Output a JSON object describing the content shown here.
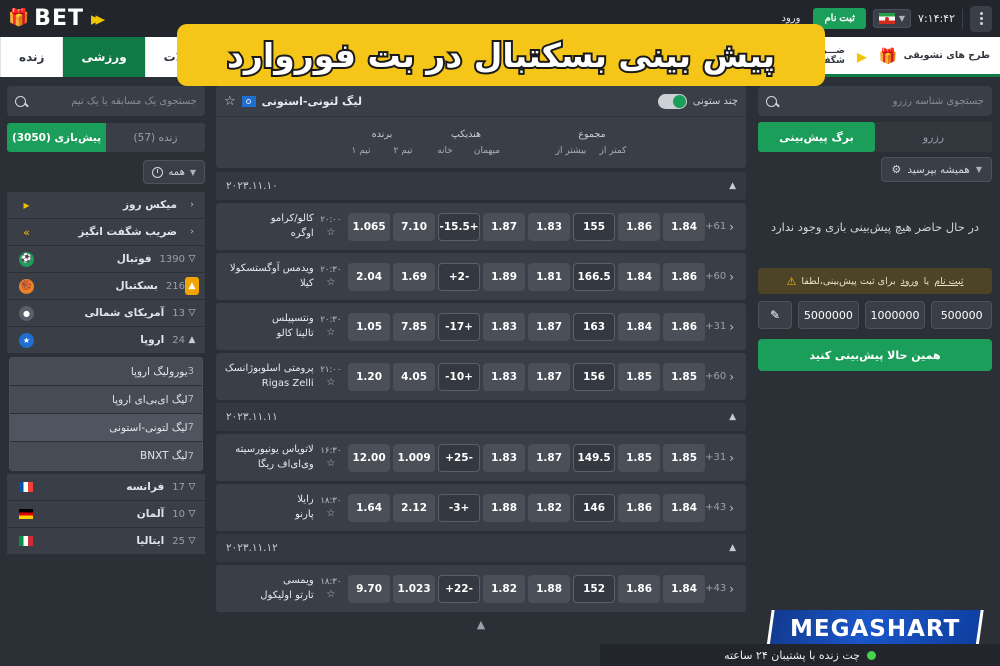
{
  "topbar": {
    "login_label": "ورود",
    "signup_label": "ثبت نام",
    "time": "۷:۱۴:۴۲",
    "brand_name": "BET",
    "lang": "فارسی"
  },
  "navbar": {
    "tabs": [
      {
        "label": "زنده",
        "active": false
      },
      {
        "label": "ورزشی",
        "active": true
      },
      {
        "label": "اسلات",
        "active": false
      }
    ],
    "promos": [
      {
        "label": "طرح های تشویقی"
      },
      {
        "label_line1": "ضـــریــب",
        "label_line2": "شگفت انگیـــز"
      }
    ]
  },
  "banner": {
    "title": "پیش بینی بسکتبال در بت فوروارد"
  },
  "right_sidebar": {
    "search_placeholder": "جستجوی یک مسابقه یا یک تیم",
    "tabs": [
      {
        "label": "پیش‌بازی (3050)",
        "active": true
      },
      {
        "label": "زنده (57)",
        "active": false
      }
    ],
    "filter": {
      "label": "همه"
    },
    "sports": [
      {
        "label": "میکس روز",
        "count": "",
        "icon": "mixday-icon",
        "chev": "‹",
        "color": "#f0c000"
      },
      {
        "label": "ضریب شگفت انگیز",
        "count": "",
        "icon": "double-arrow-icon",
        "chev": "‹",
        "color": "#f0c000"
      },
      {
        "label": "فوتبال",
        "count": "1390",
        "icon": "football-icon",
        "chev": "⌄",
        "color": "#1c9e5b"
      },
      {
        "label": "بسکتبال",
        "count": "216",
        "icon": "basketball-icon",
        "chev": "⌃",
        "color": "#e8832a",
        "selected": true
      },
      {
        "label": "آمریکای شمالی",
        "count": "13",
        "icon": "region-icon",
        "chev": "⌄",
        "color": "#5a606a"
      },
      {
        "label": "اروپا",
        "count": "24",
        "icon": "europe-icon",
        "chev": "⌃",
        "color": "#1f6fd0",
        "expanded": true
      }
    ],
    "leagues": [
      {
        "name": "یورولیگ اروپا",
        "count": "3"
      },
      {
        "name": "لیگ ای‌بی‌ای اروپا",
        "count": "7"
      },
      {
        "name": "لیگ لتونی-استونی",
        "count": "7",
        "active": true
      },
      {
        "name": "لیگ BNXT",
        "count": "7"
      }
    ],
    "countries": [
      {
        "name": "فرانسه",
        "count": "17",
        "flag": "fl-fr"
      },
      {
        "name": "آلمان",
        "count": "10",
        "flag": "fl-de"
      },
      {
        "name": "ایتالیا",
        "count": "25",
        "flag": "fl-it"
      }
    ]
  },
  "center": {
    "league_title": "لیگ لتونی-استونی",
    "multicolumn_label": "چند ستونی",
    "col_groups": [
      {
        "title": "برنده",
        "subs": [
          "تیم ۱",
          "تیم ۲"
        ]
      },
      {
        "title": "هندیکپ",
        "subs": [
          "خانه",
          "میهمان"
        ]
      },
      {
        "title": "مجموع",
        "subs": [
          "بیشتر از",
          "کمتر از"
        ]
      }
    ],
    "sections": [
      {
        "date": "۲۰۲۳.۱۱.۱۰",
        "matches": [
          {
            "team1": "کالو/کرامو",
            "team2": "اوگره",
            "time": "۲۰:۰۰",
            "o1": "1.065",
            "o2": "7.10",
            "hline": "+15.5-",
            "h1": "1.87",
            "h2": "1.83",
            "tline": "155",
            "tover": "1.86",
            "tunder": "1.84",
            "more": "61+"
          },
          {
            "team1": "ویدمس آوگستسکولا",
            "team2": "کیلا",
            "time": "۲۰:۳۰",
            "o1": "2.04",
            "o2": "1.69",
            "hline": "-2+",
            "h1": "1.89",
            "h2": "1.81",
            "tline": "166.5",
            "tover": "1.84",
            "tunder": "1.86",
            "more": "60+"
          },
          {
            "team1": "ونتسپیلس",
            "team2": "تالینا کالو",
            "time": "۲۰:۳۰",
            "o1": "1.05",
            "o2": "7.85",
            "hline": "+17-",
            "h1": "1.83",
            "h2": "1.87",
            "tline": "163",
            "tover": "1.84",
            "tunder": "1.86",
            "more": "31+"
          },
          {
            "team1": "پرومتی اسلوبوژانسک",
            "team2": "Rigas Zelli",
            "time": "۲۱:۰۰",
            "o1": "1.20",
            "o2": "4.05",
            "hline": "+10-",
            "h1": "1.83",
            "h2": "1.87",
            "tline": "156",
            "tover": "1.85",
            "tunder": "1.85",
            "more": "60+"
          }
        ]
      },
      {
        "date": "۲۰۲۳.۱۱.۱۱",
        "matches": [
          {
            "team1": "لاتویاس یونیورسیته",
            "team2": "وی‌ای‌اف ریگا",
            "time": "۱۶:۳۰",
            "o1": "12.00",
            "o2": "1.009",
            "hline": "-25+",
            "h1": "1.83",
            "h2": "1.87",
            "tline": "149.5",
            "tover": "1.85",
            "tunder": "1.85",
            "more": "31+"
          },
          {
            "team1": "رایلا",
            "team2": "پارنو",
            "time": "۱۸:۳۰",
            "o1": "1.64",
            "o2": "2.12",
            "hline": "+3-",
            "h1": "1.88",
            "h2": "1.82",
            "tline": "146",
            "tover": "1.86",
            "tunder": "1.84",
            "more": "43+"
          }
        ]
      },
      {
        "date": "۲۰۲۳.۱۱.۱۲",
        "matches": [
          {
            "team1": "ویمسی",
            "team2": "تارتو اولیکول",
            "time": "۱۸:۳۰",
            "o1": "9.70",
            "o2": "1.023",
            "hline": "-22+",
            "h1": "1.82",
            "h2": "1.88",
            "tline": "152",
            "tover": "1.86",
            "tunder": "1.84",
            "more": "43+"
          }
        ]
      }
    ]
  },
  "left_sidebar": {
    "search_placeholder": "جستجوی شناسه رزرو",
    "tabs": [
      {
        "label": "برگ پیش‌بینی",
        "active": true
      },
      {
        "label": "رزرو",
        "active": false
      }
    ],
    "option_label": "همیشه بپرسید",
    "empty_message": "در حال حاضر هیچ پیش‌بینی بازی وجود ندارد",
    "warning": {
      "prefix": "برای ثبت پیش‌بینی،لطفا",
      "link1": "ورود",
      "middle": "یا",
      "link2": "ثبت نام"
    },
    "amounts": [
      "500000",
      "1000000",
      "5000000"
    ],
    "bet_button": "همین حالا پیش‌بینی کنید",
    "watermark": "MEGASHART"
  },
  "chatbar": {
    "label": "چت زنده با پشتیبان ۲۴ ساعته"
  }
}
